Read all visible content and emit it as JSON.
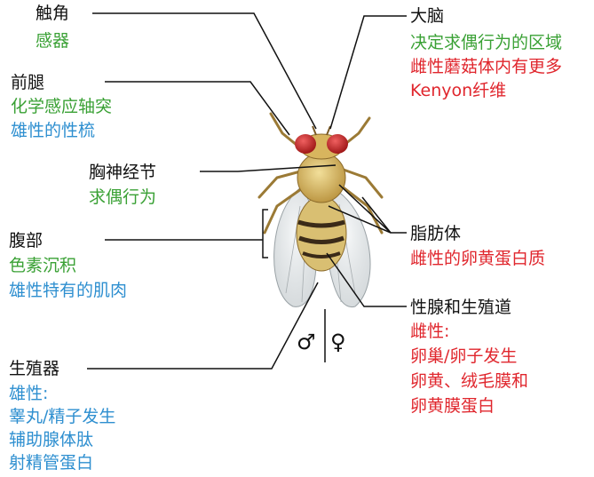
{
  "colors": {
    "title": "#111111",
    "general": "#3aa135",
    "male": "#2e8fd0",
    "female": "#e0262d",
    "eye": "#d22a2a"
  },
  "labels": {
    "antenna": {
      "title": "触角",
      "lines": [
        "感器"
      ]
    },
    "foreleg": {
      "title": "前腿",
      "lines": [
        "化学感应轴突",
        "雄性的性梳"
      ]
    },
    "thoracic": {
      "title": "胸神经节",
      "lines": [
        "求偶行为"
      ]
    },
    "abdomen": {
      "title": "腹部",
      "lines": [
        "色素沉积",
        "雄性特有的肌肉"
      ]
    },
    "genitalia": {
      "title": "生殖器",
      "lines": [
        "雄性:",
        "睾丸/精子发生",
        "辅助腺体肽",
        "射精管蛋白"
      ]
    },
    "brain": {
      "title": "大脑",
      "lines": [
        "决定求偶行为的区域",
        "雌性蘑菇体内有更多",
        "Kenyon纤维"
      ]
    },
    "fatbody": {
      "title": "脂肪体",
      "lines": [
        "雌性的卵黄蛋白质"
      ]
    },
    "gonad": {
      "title": "性腺和生殖道",
      "lines": [
        "雌性:",
        "卵巢/卵子发生",
        "卵黄、绒毛膜和",
        "卵黄膜蛋白"
      ]
    }
  },
  "sex_symbols": {
    "male": "♂",
    "female": "♀"
  }
}
